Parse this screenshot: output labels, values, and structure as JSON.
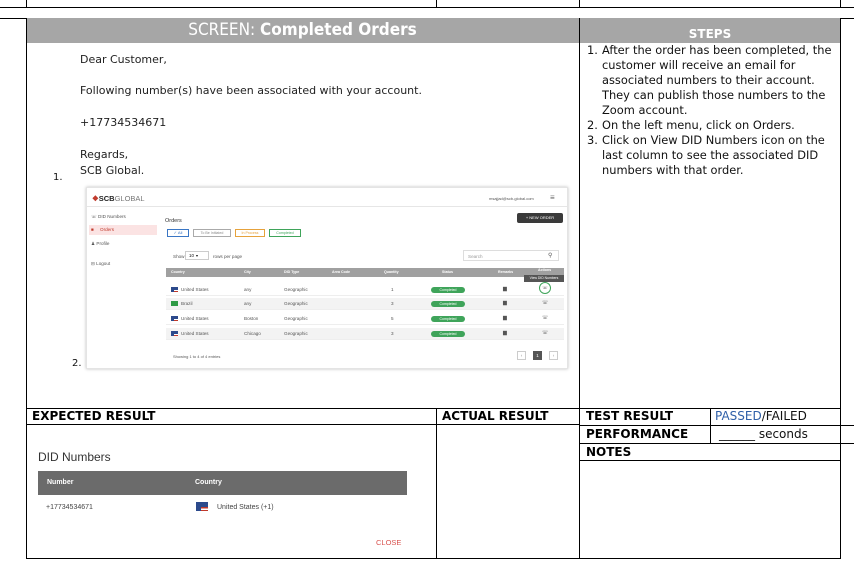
{
  "header": {
    "screen_prefix": "SCREEN: ",
    "screen_title": "Completed Orders",
    "steps_title": "STEPS"
  },
  "email": {
    "greeting": "Dear Customer,",
    "body": "Following number(s) have been associated with your account.",
    "number": "+17734534671",
    "regards": "Regards,",
    "signature": "SCB Global.",
    "item_number": "1."
  },
  "screenshot_item_number": "2.",
  "steps": [
    {
      "num": "1.",
      "text": "After the order has been completed, the customer will receive an email for associated numbers to their account. They can publish those numbers to the Zoom account."
    },
    {
      "num": "2.",
      "text": "On the left menu, click on Orders."
    },
    {
      "num": "3.",
      "text": "Click on View DID Numbers icon on the last column to see the associated DID numbers with that order."
    }
  ],
  "app": {
    "logo_bold": "SCB",
    "logo_light": "GLOBAL",
    "user_email": "msajjad@scb-global.com",
    "menu": [
      "DID Numbers",
      "Orders",
      "Profile",
      "Logout"
    ],
    "page_title": "Orders",
    "new_order": "+ NEW ORDER",
    "filters": [
      "✓ All",
      "To Be Initiated",
      "In Process",
      "Completed"
    ],
    "show_label": "Show",
    "show_value": "10",
    "rows_per_page": "rows per page",
    "search_placeholder": "Search",
    "columns": [
      "Country",
      "City",
      "DID Type",
      "Area Code",
      "Quantity",
      "Status",
      "Remarks",
      "Actions"
    ],
    "tooltip": "View DID Numbers",
    "rows": [
      {
        "country": "United States",
        "city": "any",
        "type": "Geographic",
        "qty": "1",
        "status": "Completed"
      },
      {
        "country": "Brazil",
        "city": "any",
        "type": "Geographic",
        "qty": "3",
        "status": "Completed"
      },
      {
        "country": "United States",
        "city": "Boston",
        "type": "Geographic",
        "qty": "5",
        "status": "Completed"
      },
      {
        "country": "United States",
        "city": "Chicago",
        "type": "Geographic",
        "qty": "3",
        "status": "Completed"
      }
    ],
    "footer": "Showing 1 to 4 of 4 entries",
    "current_page": "1"
  },
  "labels": {
    "expected": "EXPECTED RESULT",
    "actual": "ACTUAL RESULT",
    "test_result": "TEST RESULT",
    "passed": "PASSED",
    "failed": "/FAILED",
    "performance": "PERFORMANCE",
    "perf_value": "______ seconds",
    "notes": "NOTES"
  },
  "did_dialog": {
    "title": "DID Numbers",
    "col_number": "Number",
    "col_country": "Country",
    "number": "+17734534671",
    "country": "United States (+1)",
    "close": "CLOSE"
  },
  "colors": {
    "header_grey": "#a6a6a6",
    "passed_blue": "#2e5fa8",
    "status_green": "#3fa45a",
    "close_red": "#d9534f"
  }
}
